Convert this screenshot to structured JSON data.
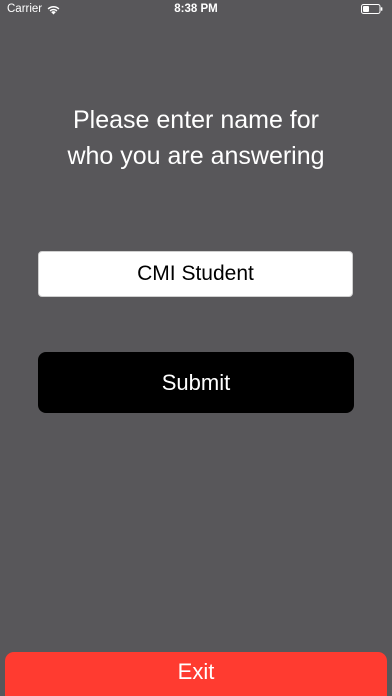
{
  "status_bar": {
    "carrier": "Carrier",
    "time": "8:38 PM",
    "wifi_icon": "wifi-icon",
    "battery_icon": "battery-icon"
  },
  "prompt": {
    "line1": "Please enter name for",
    "line2": "who you are answering"
  },
  "name_field": {
    "value": "CMI Student"
  },
  "submit_button": {
    "label": "Submit"
  },
  "exit_button": {
    "label": "Exit"
  },
  "colors": {
    "background": "#58575a",
    "submit_bg": "#000000",
    "exit_bg": "#ff3b30",
    "text": "#ffffff"
  }
}
